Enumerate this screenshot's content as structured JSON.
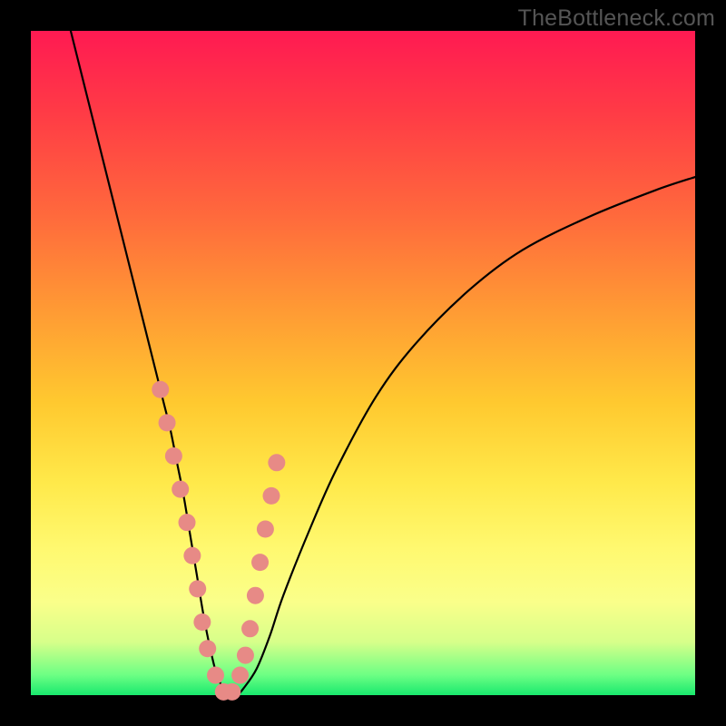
{
  "watermark": "TheBottleneck.com",
  "colors": {
    "dot": "#e78a86",
    "curve": "#000000",
    "frame": "#000000"
  },
  "chart_data": {
    "type": "line",
    "title": "",
    "xlabel": "",
    "ylabel": "",
    "xlim": [
      0,
      100
    ],
    "ylim": [
      0,
      100
    ],
    "grid": false,
    "series": [
      {
        "name": "curve",
        "x": [
          6,
          8,
          10,
          12,
          14,
          16,
          18,
          20,
          21,
          22,
          23,
          24,
          25,
          26,
          27,
          28,
          29,
          30,
          31,
          32,
          34,
          36,
          38,
          42,
          46,
          52,
          58,
          66,
          74,
          84,
          94,
          100
        ],
        "y": [
          100,
          92,
          84,
          76,
          68,
          60,
          52,
          44,
          40,
          35,
          30,
          24,
          18,
          12,
          7,
          3,
          1,
          0,
          0,
          1,
          4,
          9,
          15,
          25,
          34,
          45,
          53,
          61,
          67,
          72,
          76,
          78
        ]
      }
    ],
    "markers": {
      "name": "highlight-dots",
      "x": [
        19.5,
        20.5,
        21.5,
        22.5,
        23.5,
        24.3,
        25.1,
        25.8,
        26.6,
        27.8,
        29.0,
        30.3,
        31.5,
        32.3,
        33.0,
        33.8,
        34.5,
        35.3,
        36.2,
        37.0
      ],
      "y": [
        46,
        41,
        36,
        31,
        26,
        21,
        16,
        11,
        7,
        3,
        0.5,
        0.5,
        3,
        6,
        10,
        15,
        20,
        25,
        30,
        35
      ]
    }
  }
}
